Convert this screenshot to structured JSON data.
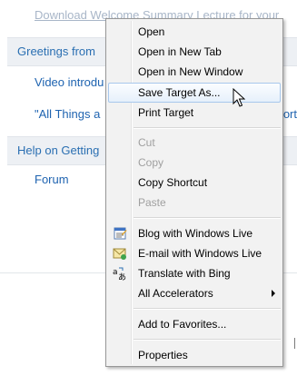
{
  "page": {
    "top_link": "Download Welcome Summary Lecture for your",
    "section1_title": "Greetings from",
    "link_video": "Video introdu",
    "link_all_things": "\"All Things a",
    "right_fragment": "ort",
    "section2_title": "Help on Getting",
    "link_forum": "Forum"
  },
  "context_menu": {
    "items": [
      {
        "label": "Open",
        "enabled": true
      },
      {
        "label": "Open in New Tab",
        "enabled": true
      },
      {
        "label": "Open in New Window",
        "enabled": true
      },
      {
        "label": "Save Target As...",
        "enabled": true,
        "highlighted": true
      },
      {
        "label": "Print Target",
        "enabled": true
      },
      {
        "label": "Cut",
        "enabled": false
      },
      {
        "label": "Copy",
        "enabled": false
      },
      {
        "label": "Copy Shortcut",
        "enabled": true
      },
      {
        "label": "Paste",
        "enabled": false
      },
      {
        "label": "Blog with Windows Live",
        "enabled": true,
        "icon": "blog-icon"
      },
      {
        "label": "E-mail with Windows Live",
        "enabled": true,
        "icon": "email-icon"
      },
      {
        "label": "Translate with Bing",
        "enabled": true,
        "icon": "translate-icon"
      },
      {
        "label": "All Accelerators",
        "enabled": true,
        "submenu": true
      },
      {
        "label": "Add to Favorites...",
        "enabled": true
      },
      {
        "label": "Properties",
        "enabled": true
      }
    ]
  },
  "colors": {
    "link": "#1e63b0",
    "menu_bg": "#f2f2f2",
    "highlight_border": "#a8c8ec",
    "disabled_text": "#a0a0a0"
  }
}
